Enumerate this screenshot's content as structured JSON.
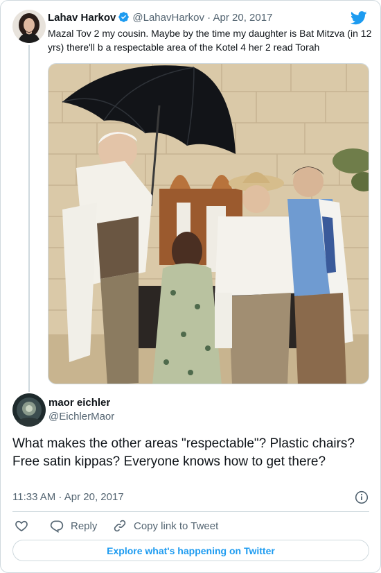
{
  "parent_tweet": {
    "author_name": "Lahav Harkov",
    "handle": "@LahavHarkov",
    "separator": "·",
    "date": "Apr 20, 2017",
    "text": "Mazal Tov 2 my cousin. Maybe by the time my daughter is Bat Mitzva (in 12 yrs) there'll b a respectable area of the Kotel 4 her 2 read Torah",
    "verified": true,
    "avatar_icon": "profile-photo-woman",
    "photo_icon": "family-torah-reading-photo"
  },
  "reply_tweet": {
    "author_name": "maor eichler",
    "handle": "@EichlerMaor",
    "text": "What makes the other areas \"respectable\"? Plastic chairs? Free satin kippas? Everyone knows how to get there?",
    "timestamp": "11:33 AM · Apr 20, 2017",
    "avatar_icon": "profile-photo-dark"
  },
  "actions": {
    "like_icon": "heart-icon",
    "reply_label": "Reply",
    "copy_link_label": "Copy link to Tweet"
  },
  "footer": {
    "explore_label": "Explore what's happening on Twitter"
  },
  "colors": {
    "accent": "#1d9bf0",
    "secondary_text": "#536471",
    "border": "#cfd9de",
    "like_red": "#f91880"
  }
}
